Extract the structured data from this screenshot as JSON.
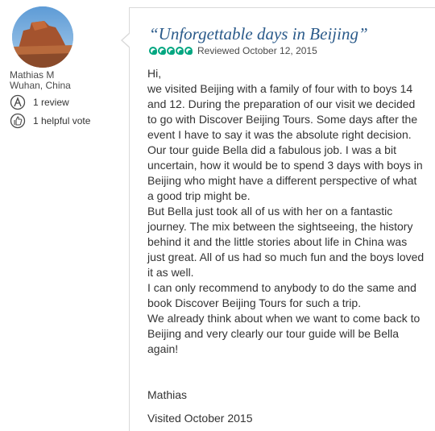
{
  "user": {
    "name": "Mathias M",
    "location": "Wuhan, China",
    "reviews": "1 review",
    "helpful_votes": "1 helpful vote",
    "reviews_icon": "reviewer-badge-icon",
    "helpful_icon": "thumbs-up-icon"
  },
  "review": {
    "title": "“Unforgettable days in Beijing”",
    "rating": 5,
    "rating_max": 5,
    "rating_color": "#00a680",
    "reviewed_date": "Reviewed October 12, 2015",
    "paragraphs": [
      "Hi,",
      "we visited Beijing with a family of four with to boys 14 and 12. During the preparation of our visit we decided to go with Discover Beijing Tours. Some days after the event I have to say it was the absolute right decision.",
      "Our tour guide Bella did a fabulous job. I was a bit uncertain, how it would be to spend 3 days with boys in Beijing who might have a different perspective of what a good trip might be.",
      "But Bella just took all of us with her on a fantastic journey. The mix between the sightseeing, the history behind it and the little stories about life in China was just great. All of us had so much fun and the boys loved it as well.",
      "I can only recommend to anybody to do the same and book Discover Beijing Tours for such a trip.",
      "We already think about when we want to come back to Beijing and very clearly our tour guide will be Bella again!"
    ],
    "signature": "Mathias",
    "visited": "Visited October 2015"
  },
  "colors": {
    "title": "#2a5a8a",
    "text": "#333333"
  }
}
